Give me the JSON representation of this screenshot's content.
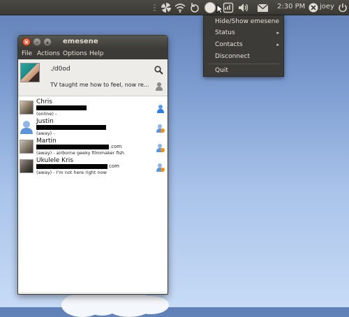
{
  "panel": {
    "clock": "2:30 PM",
    "user": "joey"
  },
  "tray_menu": {
    "items": [
      {
        "label": "Hide/Show emesene",
        "submenu": false
      },
      {
        "label": "Status",
        "submenu": true
      },
      {
        "label": "Contacts",
        "submenu": true
      },
      {
        "label": "Disconnect",
        "submenu": false
      },
      {
        "label": "Quit",
        "submenu": false
      }
    ],
    "submenu_arrow": "▸"
  },
  "window": {
    "title": "emesene",
    "close_glyph": "×",
    "min_glyph": "–",
    "max_glyph": "▴",
    "menubar": [
      "File",
      "Actions",
      "Options",
      "Help"
    ],
    "profile": {
      "nick": "./d0od",
      "message": "TV taught me how to feel, now re..."
    },
    "contacts": [
      {
        "name": "Chris",
        "status_line": "(online) -",
        "presence": "online",
        "email_suffix": ""
      },
      {
        "name": "Justin",
        "status_line": "(away) -",
        "presence": "away",
        "email_suffix": ""
      },
      {
        "name": "Martin",
        "status_line": "(away) - airborne geeky filmmaker fish",
        "presence": "away",
        "email_suffix": ".com"
      },
      {
        "name": "Ukulele Kris",
        "status_line": "(away) - I'm not here right now",
        "presence": "away",
        "email_suffix": "com"
      }
    ]
  },
  "colors": {
    "panel": "#3c3b37",
    "close_button": "#de4a1b",
    "online": "#2e7de0",
    "away": "#f0921c"
  }
}
